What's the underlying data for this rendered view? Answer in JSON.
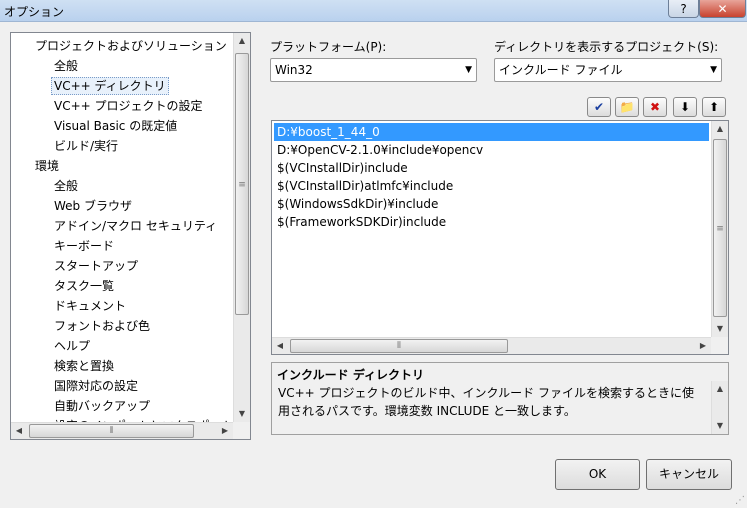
{
  "window": {
    "title": "オプション",
    "help_label": "?",
    "close_label": "✕"
  },
  "tree": {
    "items": [
      {
        "label": "プロジェクトおよびソリューション",
        "level": 0
      },
      {
        "label": "全般",
        "level": 1
      },
      {
        "label": "VC++ ディレクトリ",
        "level": 1,
        "selected": true
      },
      {
        "label": "VC++ プロジェクトの設定",
        "level": 1
      },
      {
        "label": "Visual Basic の既定値",
        "level": 1
      },
      {
        "label": "ビルド/実行",
        "level": 1
      },
      {
        "label": "環境",
        "level": 0
      },
      {
        "label": "全般",
        "level": 1
      },
      {
        "label": "Web ブラウザ",
        "level": 1
      },
      {
        "label": "アドイン/マクロ セキュリティ",
        "level": 1
      },
      {
        "label": "キーボード",
        "level": 1
      },
      {
        "label": "スタートアップ",
        "level": 1
      },
      {
        "label": "タスク一覧",
        "level": 1
      },
      {
        "label": "ドキュメント",
        "level": 1
      },
      {
        "label": "フォントおよび色",
        "level": 1
      },
      {
        "label": "ヘルプ",
        "level": 1
      },
      {
        "label": "検索と置換",
        "level": 1
      },
      {
        "label": "国際対応の設定",
        "level": 1
      },
      {
        "label": "自動バックアップ",
        "level": 1
      },
      {
        "label": "設定のインポートとエクスポート",
        "level": 1
      }
    ]
  },
  "platform": {
    "label": "プラットフォーム(P):",
    "value": "Win32"
  },
  "show_dirs": {
    "label": "ディレクトリを表示するプロジェクト(S):",
    "value": "インクルード ファイル"
  },
  "toolbar": {
    "icons": [
      "checkmark-icon",
      "new-folder-icon",
      "delete-icon",
      "move-down-icon",
      "move-up-icon"
    ],
    "glyphs": [
      "✔",
      "📁",
      "✖",
      "⬇",
      "⬆"
    ]
  },
  "directories": {
    "rows": [
      {
        "text": "D:¥boost_1_44_0",
        "selected": true
      },
      {
        "text": "D:¥OpenCV-2.1.0¥include¥opencv"
      },
      {
        "text": "$(VCInstallDir)include"
      },
      {
        "text": "$(VCInstallDir)atlmfc¥include"
      },
      {
        "text": "$(WindowsSdkDir)¥include"
      },
      {
        "text": "$(FrameworkSDKDir)include"
      }
    ]
  },
  "description": {
    "title": "インクルード ディレクトリ",
    "body": "VC++ プロジェクトのビルド中、インクルード ファイルを検索するときに使用されるパスです。環境変数 INCLUDE と一致します。"
  },
  "buttons": {
    "ok": "OK",
    "cancel": "キャンセル"
  },
  "colors": {
    "selection": "#3399ff",
    "title_bar": "#cfe0f3",
    "close_button": "#c8422e"
  }
}
